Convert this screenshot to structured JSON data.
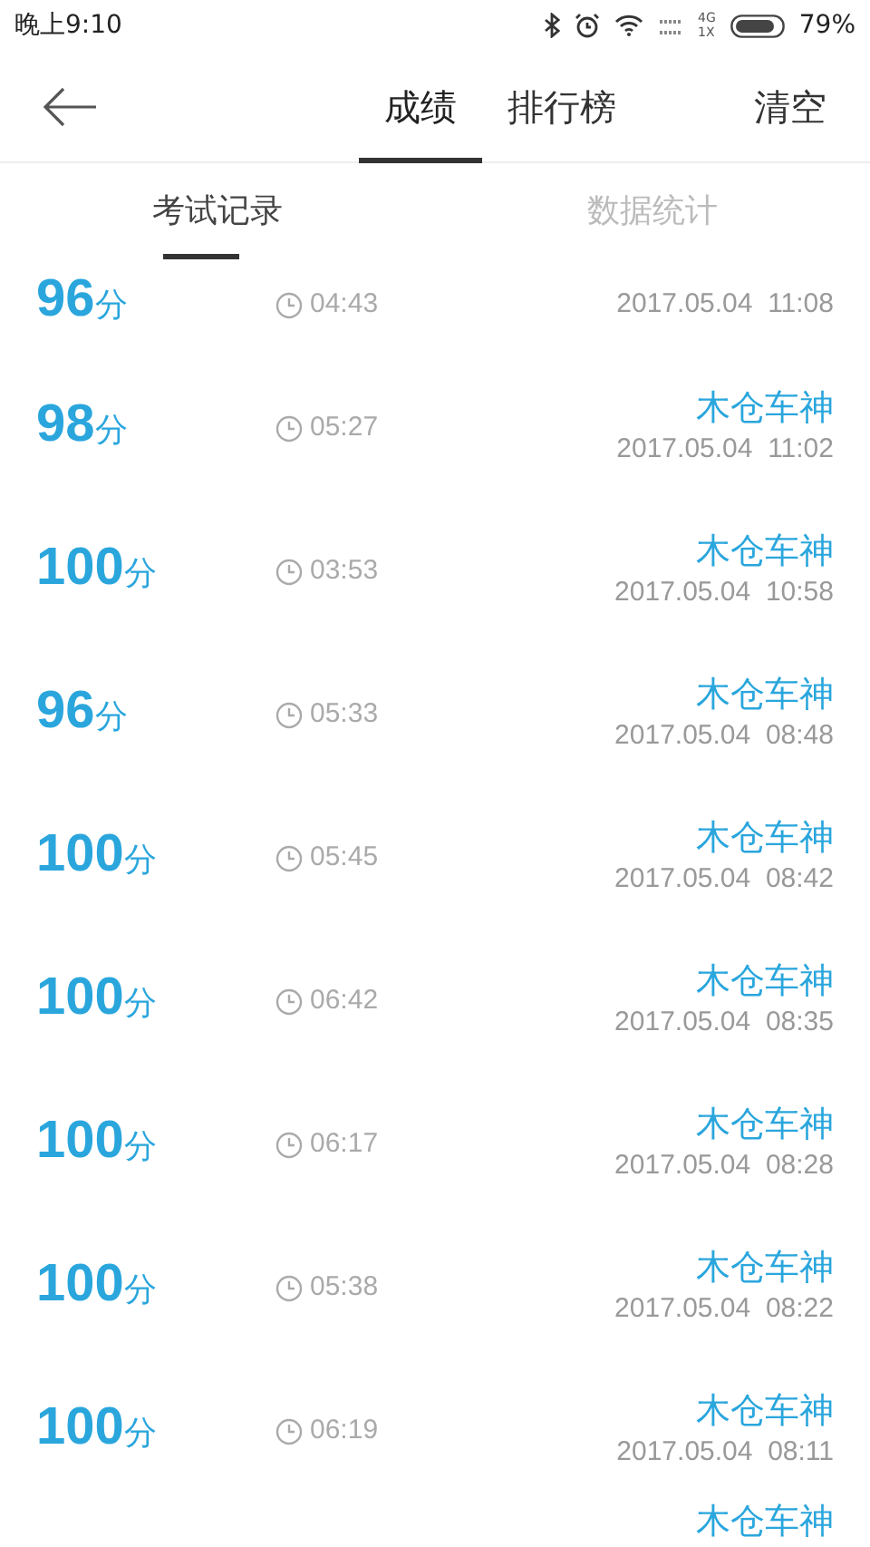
{
  "status_bar": {
    "time": "晚上9:10",
    "network_top": "4G",
    "network_bottom": "1X",
    "battery": "79%"
  },
  "header": {
    "tabs": [
      {
        "label": "成绩",
        "selected": true
      },
      {
        "label": "排行榜",
        "selected": false
      }
    ],
    "action": "清空"
  },
  "sub_tabs": [
    {
      "label": "考试记录",
      "selected": true
    },
    {
      "label": "数据统计",
      "selected": false
    }
  ],
  "records": [
    {
      "score": "96",
      "unit": "分",
      "duration": "04:43",
      "date": "2017.05.04  11:08"
    },
    {
      "score": "98",
      "unit": "分",
      "duration": "05:27",
      "name": "木仓车神",
      "date": "2017.05.04  11:02"
    },
    {
      "score": "100",
      "unit": "分",
      "duration": "03:53",
      "name": "木仓车神",
      "date": "2017.05.04  10:58"
    },
    {
      "score": "96",
      "unit": "分",
      "duration": "05:33",
      "name": "木仓车神",
      "date": "2017.05.04  08:48"
    },
    {
      "score": "100",
      "unit": "分",
      "duration": "05:45",
      "name": "木仓车神",
      "date": "2017.05.04  08:42"
    },
    {
      "score": "100",
      "unit": "分",
      "duration": "06:42",
      "name": "木仓车神",
      "date": "2017.05.04  08:35"
    },
    {
      "score": "100",
      "unit": "分",
      "duration": "06:17",
      "name": "木仓车神",
      "date": "2017.05.04  08:28"
    },
    {
      "score": "100",
      "unit": "分",
      "duration": "05:38",
      "name": "木仓车神",
      "date": "2017.05.04  08:22"
    },
    {
      "score": "100",
      "unit": "分",
      "duration": "06:19",
      "name": "木仓车神",
      "date": "2017.05.04  08:11"
    },
    {
      "name": "木仓车神"
    }
  ]
}
